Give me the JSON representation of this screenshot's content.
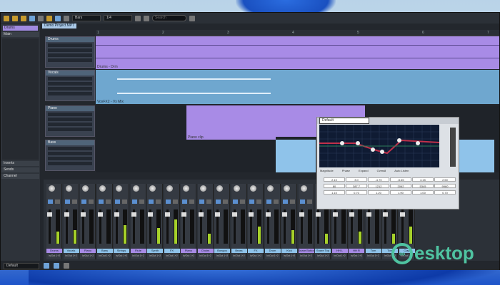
{
  "toolbar": {
    "timebase": "Bars",
    "quantize": "1/4",
    "search_placeholder": "Search"
  },
  "song_tab": "Demo Project.MP7",
  "left_panel": {
    "selected": "Drums",
    "section_main": "Main",
    "section_inserts": "Inserts",
    "section_sends": "Sends",
    "section_channel": "Channel"
  },
  "ruler": [
    "1",
    "2",
    "3",
    "4",
    "5",
    "6",
    "7"
  ],
  "tracks": [
    {
      "name": "Drums",
      "color": "#a88be6"
    },
    {
      "name": "Vocals",
      "color": "#6fa7cf"
    },
    {
      "name": "Piano",
      "color": "#a88be6"
    },
    {
      "name": "Bass",
      "color": "#8fc3ea"
    }
  ],
  "clip_labels": {
    "drums": "Drums - Drm",
    "vocals": "VoxFX2 - Vx Mix",
    "piano": "Piano clip"
  },
  "eq": {
    "preset": "Default",
    "labels": [
      "Magnitude",
      "Phase",
      "Expand",
      "Overall",
      "Auto Listen"
    ],
    "bands": [
      {
        "gain": "2.10",
        "freq": "80",
        "q": "1.10"
      },
      {
        "gain": "3.0",
        "freq": "387.7",
        "q": "0.70"
      },
      {
        "gain": "-4.70",
        "freq": "1212",
        "q": "1.20"
      },
      {
        "gain": "-5.65",
        "freq": "2062",
        "q": "1.90"
      },
      {
        "gain": "4.15",
        "freq": "5345",
        "q": "1.00"
      },
      {
        "gain": "2.50",
        "freq": "9960",
        "q": "0.70"
      }
    ],
    "accent": "#c0304a"
  },
  "mixer": {
    "channels": [
      {
        "name": "Drums",
        "color": "#a88be6",
        "level": 0.35
      },
      {
        "name": "Vocals",
        "color": "#8fc3ea",
        "level": 0.4
      },
      {
        "name": "Piano",
        "color": "#a88be6",
        "level": 0
      },
      {
        "name": "Bass",
        "color": "#8fc3ea",
        "level": 0
      },
      {
        "name": "Strings",
        "color": "#8fc3ea",
        "level": 0.55
      },
      {
        "name": "Flute",
        "color": "#a88be6",
        "level": 0
      },
      {
        "name": "Synth",
        "color": "#8fc3ea",
        "level": 0.45
      },
      {
        "name": "FX",
        "color": "#8fc3ea",
        "level": 0.7
      },
      {
        "name": "Piano",
        "color": "#a88be6",
        "level": 0
      },
      {
        "name": "Choirs",
        "color": "#a88be6",
        "level": 0.3
      },
      {
        "name": "Bongos",
        "color": "#8fc3ea",
        "level": 0
      },
      {
        "name": "Brass",
        "color": "#8fc3ea",
        "level": 0
      },
      {
        "name": "FX",
        "color": "#8fc3ea",
        "level": 0.5
      },
      {
        "name": "Drum",
        "color": "#8fc3ea",
        "level": 0
      },
      {
        "name": "Kick",
        "color": "#8fc3ea",
        "level": 0.4
      },
      {
        "name": "Snare Bottom",
        "color": "#a88be6",
        "level": 0
      },
      {
        "name": "Snare Top",
        "color": "#8fc3ea",
        "level": 0.3
      },
      {
        "name": "HH L",
        "color": "#a88be6",
        "level": 0
      },
      {
        "name": "HH R",
        "color": "#a88be6",
        "level": 0.35
      },
      {
        "name": "Tom",
        "color": "#8fc3ea",
        "level": 0
      },
      {
        "name": "Tom",
        "color": "#8fc3ea",
        "level": 0.3
      },
      {
        "name": "Clap",
        "color": "#8fc3ea",
        "level": 0.5
      }
    ],
    "output": "In/Out 1+2",
    "solo_label": "S",
    "mute_label": "M"
  },
  "bottom": {
    "workspace": "Default"
  },
  "watermark": "esktop"
}
